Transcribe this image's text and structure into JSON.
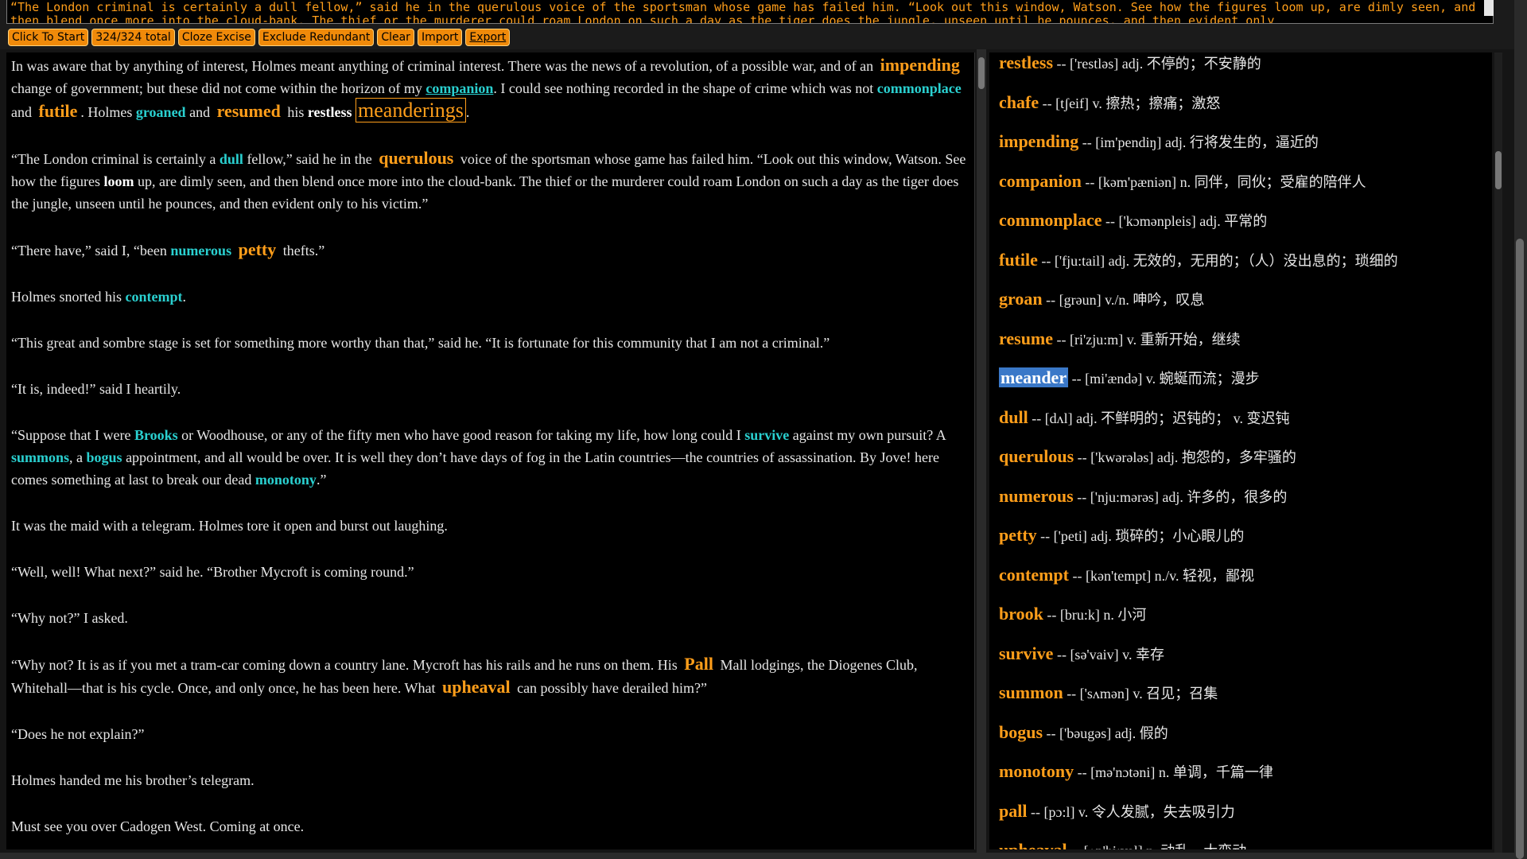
{
  "top_text": "“The London criminal is certainly a dull fellow,” said he in the querulous voice of the sportsman whose game has failed him. “Look out this window, Watson. See how the figures loom up, are dimly seen, and then blend once more into the cloud-bank. The thief or the murderer could roam London on such a day as the tiger does the jungle, unseen until he pounces, and then evident only",
  "toolbar": {
    "click_to_start": "Click To Start",
    "count": "324/324 total",
    "cloze_excise": "Cloze Excise",
    "exclude_redundant": "Exclude Redundant",
    "clear": "Clear",
    "import": "Import",
    "export": "Export"
  },
  "reading": {
    "p1": {
      "a": "In was aware that by anything of interest, Holmes meant anything of criminal interest. There was the news of a revolution, of a possible war, and of an",
      "impending": "impending",
      "b": "change of government; but these did not come within the horizon of my",
      "companion": "companion",
      "c": ". I could see nothing recorded in the shape of crime which was not",
      "commonplace": "commonplace",
      "d": "and",
      "futile": "futile",
      "e": ". Holmes",
      "groaned": "groaned",
      "f": "and",
      "resumed": "resumed",
      "g": "his",
      "restless": "restless",
      "meanderings": "meanderings",
      "h": "."
    },
    "p2": {
      "a": "“The London criminal is certainly a",
      "dull": "dull",
      "b": "fellow,” said he in the",
      "querulous": "querulous",
      "c": "voice of the sportsman whose game has failed him. “Look out this window, Watson. See how the figures",
      "loom": "loom",
      "d": "up, are dimly seen, and then blend once more into the cloud-bank. The thief or the murderer could roam London on such a day as the tiger does the jungle, unseen until he pounces, and then evident only to his victim.”"
    },
    "p3": {
      "a": "“There have,” said I, “been",
      "numerous": "numerous",
      "petty": "petty",
      "b": "thefts.”"
    },
    "p4": {
      "a": "Holmes snorted his",
      "contempt": "contempt",
      "b": "."
    },
    "p5": "“This great and sombre stage is set for something more worthy than that,” said he. “It is fortunate for this community that I am not a criminal.”",
    "p6": "“It is, indeed!” said I heartily.",
    "p7": {
      "a": "“Suppose that I were",
      "brooks": "Brooks",
      "b": "or Woodhouse, or any of the fifty men who have good reason for taking my life, how long could I",
      "survive": "survive",
      "c": "against my own pursuit? A",
      "summons": "summons",
      "d": ", a",
      "bogus": "bogus",
      "e": "appointment, and all would be over. It is well they don’t have days of fog in the Latin countries—the countries of assassination. By Jove! here comes something at last to break our dead",
      "monotony": "monotony",
      "f": ".”"
    },
    "p8": "It was the maid with a telegram. Holmes tore it open and burst out laughing.",
    "p9": "“Well, well! What next?” said he. “Brother Mycroft is coming round.”",
    "p10": "“Why not?” I asked.",
    "p11": {
      "a": "“Why not? It is as if you met a tram-car coming down a country lane. Mycroft has his rails and he runs on them. His",
      "pall": "Pall",
      "b": "Mall lodgings, the Diogenes Club, Whitehall—that is his cycle. Once, and only once, he has been here. What",
      "upheaval": "upheaval",
      "c": "can possibly have derailed him?”"
    },
    "p12": "“Does he not explain?”",
    "p13": "Holmes handed me his brother’s telegram.",
    "p14": "Must see you over Cadogen West. Coming at once."
  },
  "dictionary": [
    {
      "word": "restless",
      "def": "-- ['restləs] adj. 不停的；不安静的"
    },
    {
      "word": "chafe",
      "def": "-- [tʃeif] v. 擦热；擦痛；激怒"
    },
    {
      "word": "impending",
      "def": "-- [im'pendiŋ] adj. 行将发生的，逼近的"
    },
    {
      "word": "companion",
      "def": "-- [kəm'pæniən] n. 同伴，同伙；受雇的陪伴人"
    },
    {
      "word": "commonplace",
      "def": "-- ['kɔmənpleis] adj. 平常的"
    },
    {
      "word": "futile",
      "def": "-- ['fju:tail] adj. 无效的，无用的；（人）没出息的；琐细的"
    },
    {
      "word": "groan",
      "def": "-- [grəun] v./n. 呻吟，叹息"
    },
    {
      "word": "resume",
      "def": "-- [ri'zju:m] v. 重新开始，继续"
    },
    {
      "word": "meander",
      "def": "-- [mi'ændə] v. 蜿蜒而流；漫步"
    },
    {
      "word": "dull",
      "def": "-- [dʌl] adj. 不鲜明的；迟钝的； v. 变迟钝"
    },
    {
      "word": "querulous",
      "def": "-- ['kwərələs] adj. 抱怨的，多牢骚的"
    },
    {
      "word": "numerous",
      "def": "-- ['nju:mərəs] adj. 许多的，很多的"
    },
    {
      "word": "petty",
      "def": "-- ['peti] adj. 琐碎的；小心眼儿的"
    },
    {
      "word": "contempt",
      "def": "-- [kən'tempt] n./v. 轻视，鄙视"
    },
    {
      "word": "brook",
      "def": "-- [bru:k] n. 小河"
    },
    {
      "word": "survive",
      "def": "-- [sə'vaiv] v. 幸存"
    },
    {
      "word": "summon",
      "def": "-- ['sʌmən] v. 召见；召集"
    },
    {
      "word": "bogus",
      "def": "-- ['bəugəs] adj. 假的"
    },
    {
      "word": "monotony",
      "def": "-- [mə'nɔtəni] n. 单调，千篇一律"
    },
    {
      "word": "pall",
      "def": "-- [pɔ:l] v. 令人发腻，失去吸引力"
    },
    {
      "word": "upheaval",
      "def": "-- [ʌp'hi:vəl] n. 动乱，大变动"
    }
  ],
  "colors": {
    "accent_orange": "#ff9e1a",
    "highlight_cyan": "#2ad0d0",
    "selection_blue": "#3a78c8"
  }
}
